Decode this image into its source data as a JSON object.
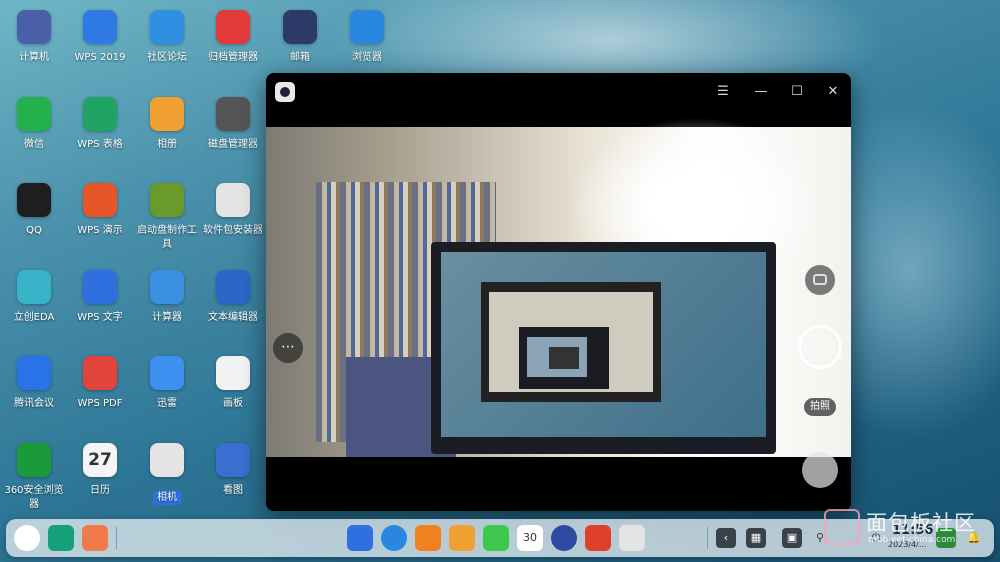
{
  "desktop": {
    "icons": [
      {
        "label": "计算机",
        "icon": "computer-icon",
        "color": "#4a5fa8"
      },
      {
        "label": "WPS 2019",
        "icon": "wps-icon",
        "color": "#2f7ae5"
      },
      {
        "label": "社区论坛",
        "icon": "forum-icon",
        "color": "#2f8fe0"
      },
      {
        "label": "归档管理器",
        "icon": "archive-icon",
        "color": "#e23a3a"
      },
      {
        "label": "邮箱",
        "icon": "mail-icon",
        "color": "#2b3a66"
      },
      {
        "label": "浏览器",
        "icon": "browser-icon",
        "color": "#2a87e0"
      },
      {
        "label": "微信",
        "icon": "wechat-icon",
        "color": "#22b14c"
      },
      {
        "label": "WPS 表格",
        "icon": "wps-sheet-icon",
        "color": "#1fa463"
      },
      {
        "label": "相册",
        "icon": "album-icon",
        "color": "#f0a030"
      },
      {
        "label": "磁盘管理器",
        "icon": "disk-icon",
        "color": "#555555"
      },
      {
        "label": "QQ",
        "icon": "qq-icon",
        "color": "#1e1e1e"
      },
      {
        "label": "WPS 演示",
        "icon": "wps-slides-icon",
        "color": "#e8552b"
      },
      {
        "label": "启动盘制作工具",
        "icon": "bootdisk-icon",
        "color": "#6a9a2a"
      },
      {
        "label": "软件包安装器",
        "icon": "package-icon",
        "color": "#e4e4e4"
      },
      {
        "label": "立创EDA",
        "icon": "eda-icon",
        "color": "#36b3c7"
      },
      {
        "label": "WPS 文字",
        "icon": "wps-writer-icon",
        "color": "#2f6fe0"
      },
      {
        "label": "计算器",
        "icon": "calculator-icon",
        "color": "#3a8fe0"
      },
      {
        "label": "文本编辑器",
        "icon": "text-editor-icon",
        "color": "#2a67c9"
      },
      {
        "label": "腾讯会议",
        "icon": "meeting-icon",
        "color": "#2a72e8"
      },
      {
        "label": "WPS PDF",
        "icon": "wps-pdf-icon",
        "color": "#e2443b"
      },
      {
        "label": "迅雷",
        "icon": "thunder-icon",
        "color": "#3d8ff0"
      },
      {
        "label": "画板",
        "icon": "draw-icon",
        "color": "#f2f2f2"
      },
      {
        "label": "360安全浏览器",
        "icon": "browser-360-icon",
        "color": "#1a9a3a"
      },
      {
        "label": "日历",
        "icon": "calendar-icon",
        "color": "#f4f4f4",
        "badge": "27"
      },
      {
        "label": "相机",
        "icon": "camera-icon",
        "color": "#e4e4e4",
        "selected": true
      },
      {
        "label": "看图",
        "icon": "image-viewer-icon",
        "color": "#3a6fd0"
      }
    ]
  },
  "camera_window": {
    "menu_glyph": "☰",
    "minimize_glyph": "—",
    "maximize_glyph": "☐",
    "close_glyph": "✕",
    "more_glyph": "⋯",
    "shoot_label": "拍照"
  },
  "dock": {
    "calendar_day": "30",
    "clock_time": "11:56",
    "clock_date": "2023/4/..."
  },
  "watermark": {
    "text": "面包板社区",
    "url": "mbb.eet-china.com"
  }
}
